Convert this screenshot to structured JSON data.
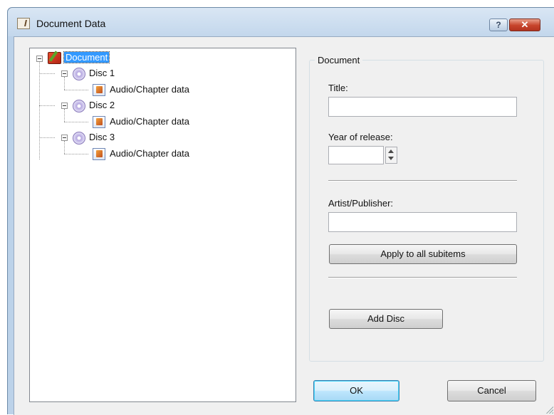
{
  "window": {
    "title": "Document Data",
    "help_glyph": "?",
    "close_glyph": "✕"
  },
  "tree": {
    "root": {
      "label": "Document"
    },
    "discs": [
      {
        "label": "Disc 1",
        "child": "Audio/Chapter data"
      },
      {
        "label": "Disc 2",
        "child": "Audio/Chapter data"
      },
      {
        "label": "Disc 3",
        "child": "Audio/Chapter data"
      }
    ]
  },
  "panel": {
    "group_title": "Document",
    "title_label": "Title:",
    "title_value": "",
    "year_label": "Year of release:",
    "year_value": "",
    "artist_label": "Artist/Publisher:",
    "artist_value": "",
    "apply_button": "Apply to all subitems",
    "add_disc_button": "Add Disc"
  },
  "footer": {
    "ok_button": "OK",
    "cancel_button": "Cancel"
  }
}
